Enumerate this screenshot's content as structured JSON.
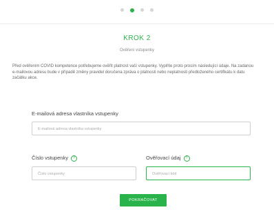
{
  "stepper": {
    "total": 4,
    "active_index": 1
  },
  "step": {
    "title": "KROK 2",
    "subtitle": "Ověření vstupenky",
    "intro": "Před ověřením COVID kompetence potřebujeme ověřit platnost vaší vstupenky. Vyplňte proto prosím následující údaje. Na zadanou e-mailovou adresu bude v případě změny pravidel doručena zpráva o platnosti nebo neplatnosti předloženého certifikátu k datu začátku akce."
  },
  "form": {
    "email_label": "E-mailová adresa vlastníka vstupenky",
    "email_placeholder": "E-mailová adresa vlastníka vstupenky",
    "ticket_label": "Číslo vstupenky",
    "ticket_placeholder": "Číslo vstupenky",
    "verify_label": "Ověřovací údaj",
    "verify_placeholder": "Ověřovací kód",
    "help_glyph": "?",
    "submit_label": "POKRAČOVAT"
  },
  "colors": {
    "accent": "#29b34a",
    "border": "#cfcfcf"
  }
}
